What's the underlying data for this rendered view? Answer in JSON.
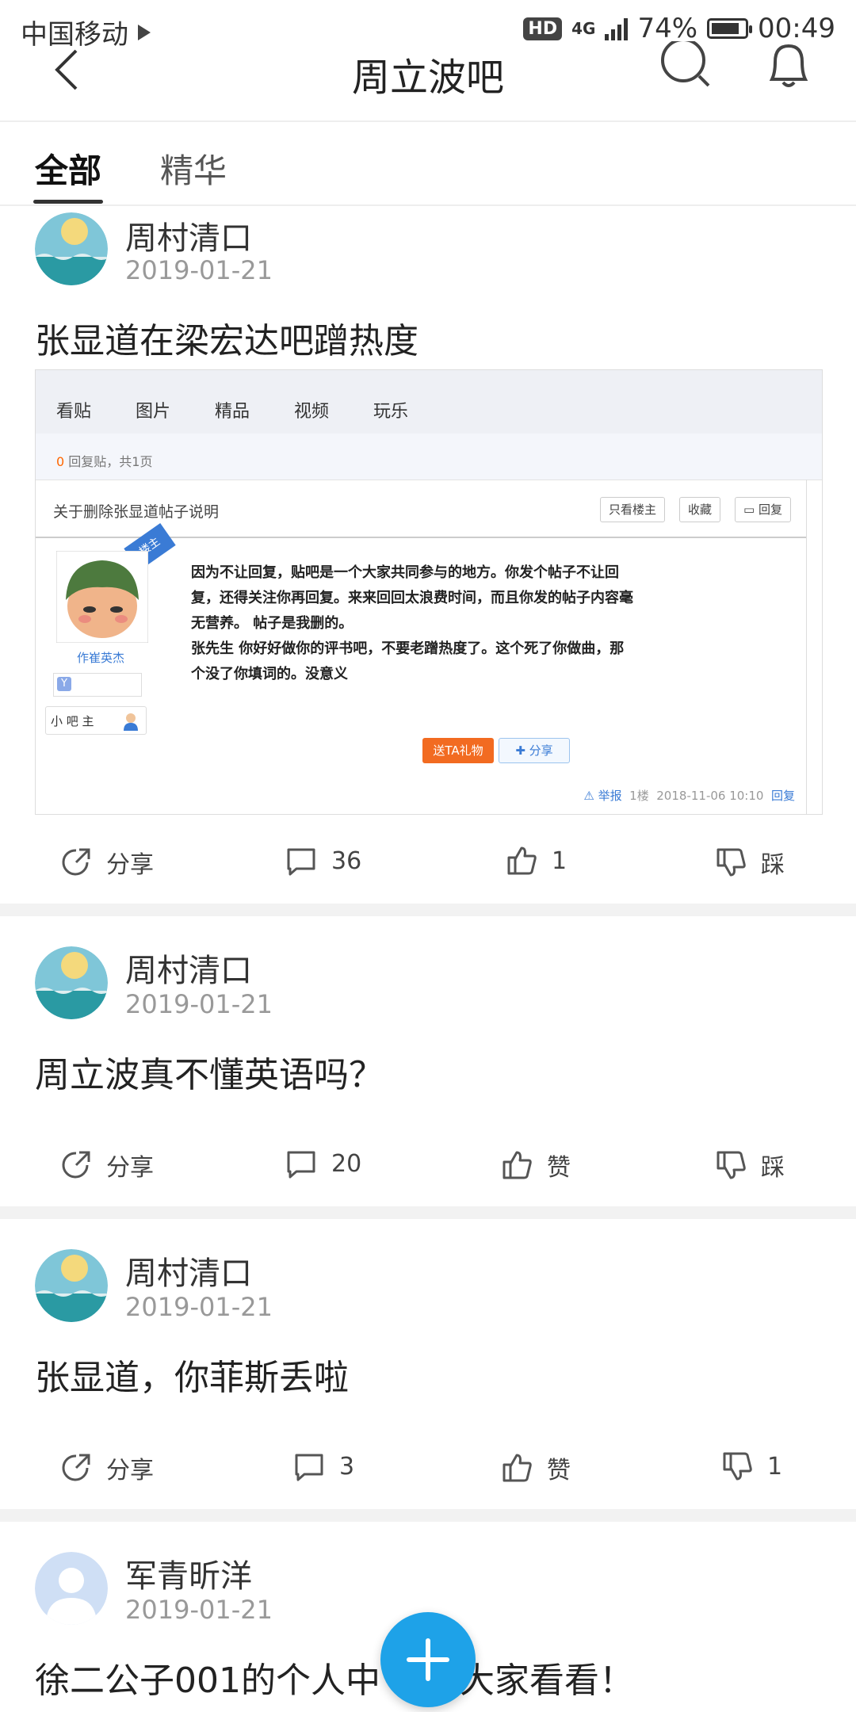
{
  "status_bar": {
    "carrier": "中国移动",
    "hd": "HD",
    "network": "4G",
    "battery": "74%",
    "time": "00:49"
  },
  "header": {
    "title": "周立波吧"
  },
  "tabs": [
    {
      "label": "全部",
      "active": true
    },
    {
      "label": "精华",
      "active": false
    }
  ],
  "posts": [
    {
      "author": "周村清口",
      "date": "2019-01-21",
      "title": "张显道在梁宏达吧蹭热度",
      "share_label": "分享",
      "comments": "36",
      "likes": "1",
      "dislike": "踩",
      "embedded": {
        "nav": [
          "看贴",
          "图片",
          "精品",
          "视频",
          "玩乐"
        ],
        "count_num": "0",
        "count_text": "回复贴，共1页",
        "post_title": "关于删除张显道帖子说明",
        "btn_only_op": "只看楼主",
        "btn_fav": "收藏",
        "btn_reply": "回复",
        "op_badge": "楼主",
        "username": "作崔英杰",
        "role": "小 吧 主",
        "body": "因为不让回复，贴吧是一个大家共同参与的地方。你发个帖子不让回复，还得关注你再回复。来来回回太浪费时间，而且你发的帖子内容毫无营养。 帖子是我删的。\n张先生 你好好做你的评书吧，不要老蹭热度了。这个死了你做曲，那个没了你填词的。没意义",
        "gift": "送TA礼物",
        "share": "分享",
        "report": "举报",
        "floor": "1楼",
        "time": "2018-11-06 10:10",
        "reply": "回复"
      }
    },
    {
      "author": "周村清口",
      "date": "2019-01-21",
      "title": "周立波真不懂英语吗？",
      "share_label": "分享",
      "comments": "20",
      "likes": "赞",
      "dislike": "踩"
    },
    {
      "author": "周村清口",
      "date": "2019-01-21",
      "title": "张显道，你菲斯丢啦",
      "share_label": "分享",
      "comments": "3",
      "likes": "赞",
      "dislike": "1"
    },
    {
      "author": "军青昕洋",
      "date": "2019-01-21",
      "title_left": "徐二公子001的个人中",
      "title_right": "大家看看！"
    }
  ],
  "colors": {
    "fab": "#1ea2e8",
    "accent_blue": "#3a7bd5",
    "gift_orange": "#f26b21"
  }
}
